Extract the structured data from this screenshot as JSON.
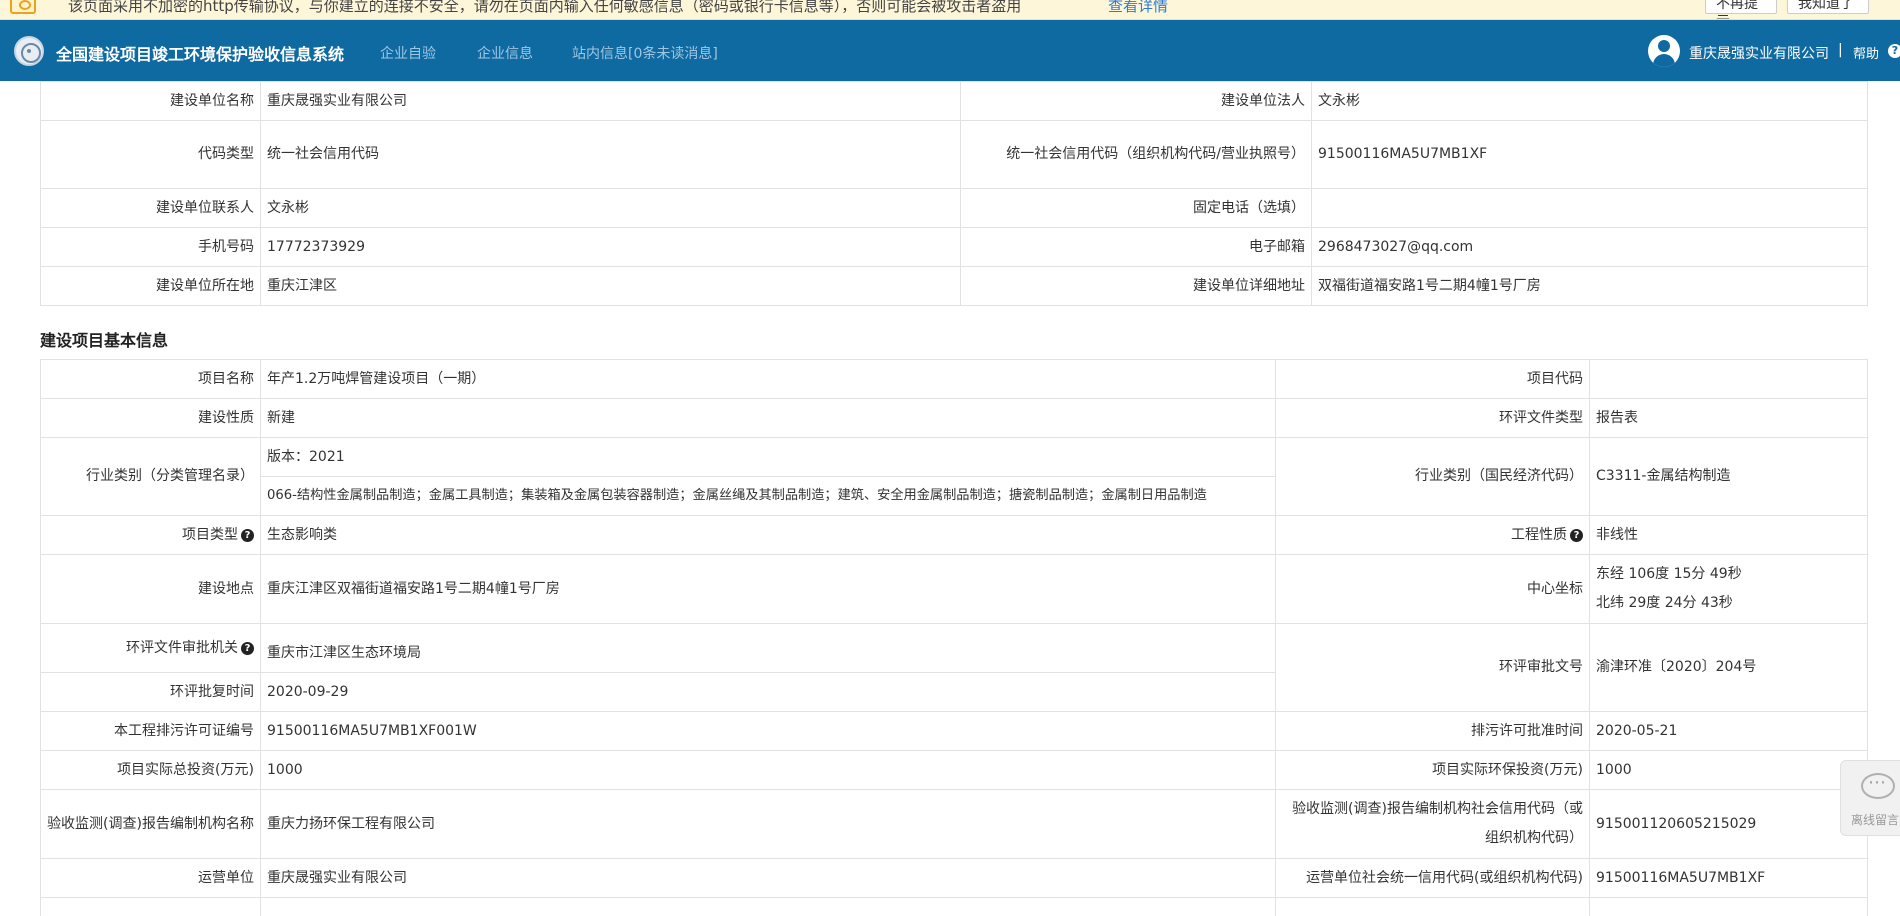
{
  "warning": {
    "text": "该页面采用不加密的http传输协议，与你建立的连接不安全，请勿在页面内输入任何敏感信息（密码或银行卡信息等），否则可能会被攻击者盗用",
    "link": "查看详情",
    "btn_no_remind": "不再提示",
    "btn_ok": "我知道了"
  },
  "header": {
    "title": "全国建设项目竣工环境保护验收信息系统",
    "nav": [
      "企业自验",
      "企业信息",
      "站内信息[0条未读消息]"
    ],
    "company": "重庆晟强实业有限公司",
    "separator": "|",
    "help": "帮助",
    "help_icon": "?"
  },
  "unit_info": {
    "rows": [
      {
        "l1": "建设单位名称",
        "v1": "重庆晟强实业有限公司",
        "l2": "建设单位法人",
        "v2": "文永彬"
      },
      {
        "l1": "代码类型",
        "v1": "统一社会信用代码",
        "l2": "统一社会信用代码（组织机构代码/营业执照号）",
        "v2": "91500116MA5U7MB1XF"
      },
      {
        "l1": "建设单位联系人",
        "v1": "文永彬",
        "l2": "固定电话（选填）",
        "v2": ""
      },
      {
        "l1": "手机号码",
        "v1": "17772373929",
        "l2": "电子邮箱",
        "v2": "2968473027@qq.com"
      },
      {
        "l1": "建设单位所在地",
        "v1": "重庆江津区",
        "l2": "建设单位详细地址",
        "v2": "双福街道福安路1号二期4幢1号厂房"
      }
    ]
  },
  "project_info": {
    "section_title": "建设项目基本信息",
    "project_name_label": "项目名称",
    "project_name": "年产1.2万吨焊管建设项目（一期）",
    "project_code_label": "项目代码",
    "project_code": "",
    "nature_label": "建设性质",
    "nature": "新建",
    "eia_type_label": "环评文件类型",
    "eia_type": "报告表",
    "industry_label": "行业类别（分类管理名录）",
    "industry_version": "版本：2021",
    "industry_desc": "066-结构性金属制品制造；金属工具制造；集装箱及金属包装容器制造；金属丝绳及其制品制造；建筑、安全用金属制品制造；搪瓷制品制造；金属制日用品制造",
    "industry_nat_label": "行业类别（国民经济代码）",
    "industry_nat": "C3311-金属结构制造",
    "project_type_label": "项目类型",
    "project_type": "生态影响类",
    "eng_nature_label": "工程性质",
    "eng_nature": "非线性",
    "location_label": "建设地点",
    "location": "重庆江津区双福街道福安路1号二期4幢1号厂房",
    "center_label": "中心坐标",
    "center_lng": "东经 106度 15分 49秒",
    "center_lat": "北纬 29度 24分 43秒",
    "approval_org_label": "环评文件审批机关",
    "approval_org": "重庆市江津区生态环境局",
    "approval_no_label": "环评审批文号",
    "approval_no": "渝津环准〔2020〕204号",
    "approval_time_label": "环评批复时间",
    "approval_time": "2020-09-29",
    "permit_no_label": "本工程排污许可证编号",
    "permit_no": "91500116MA5U7MB1XF001W",
    "permit_time_label": "排污许可批准时间",
    "permit_time": "2020-05-21",
    "invest_label": "项目实际总投资(万元)",
    "invest": "1000",
    "env_invest_label": "项目实际环保投资(万元)",
    "env_invest": "1000",
    "report_org_label": "验收监测(调查)报告编制机构名称",
    "report_org": "重庆力扬环保工程有限公司",
    "report_code_label": "验收监测(调查)报告编制机构社会信用代码（或组织机构代码）",
    "report_code": "915001120605215029",
    "operator_label": "运营单位",
    "operator": "重庆晟强实业有限公司",
    "operator_code_label": "运营单位社会统一信用代码(或组织机构代码)",
    "operator_code": "91500116MA5U7MB1XF",
    "help_mark": "?"
  },
  "float_widget": {
    "label": "离线留言"
  }
}
